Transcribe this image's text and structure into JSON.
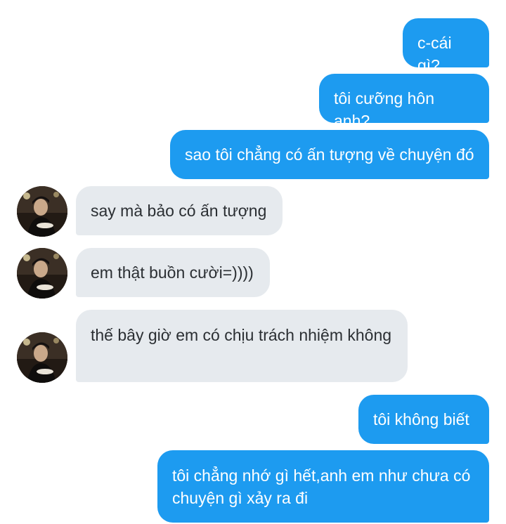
{
  "conversation": {
    "messages": [
      {
        "side": "out",
        "text": "c-cái gì?"
      },
      {
        "side": "out",
        "text": "tôi cưỡng hôn anh?"
      },
      {
        "side": "out",
        "text": "sao tôi chẳng có ấn tượng về chuyện đó"
      },
      {
        "side": "in",
        "text": "say mà bảo có ấn tượng"
      },
      {
        "side": "in",
        "text": "em thật buồn cười=))))"
      },
      {
        "side": "in",
        "text": "thế bây giờ em có chịu trách nhiệm không"
      },
      {
        "side": "out",
        "text": "tôi không biết"
      },
      {
        "side": "out",
        "text": "tôi chẳng nhớ gì hết,anh em như chưa có chuyện gì xảy ra đi"
      }
    ]
  },
  "colors": {
    "outgoing_bubble": "#1d9bf0",
    "incoming_bubble": "#e6eaee",
    "outgoing_text": "#ffffff",
    "incoming_text": "#2b2f33"
  }
}
